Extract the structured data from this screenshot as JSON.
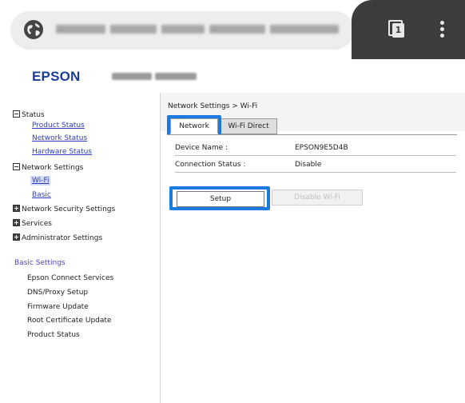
{
  "browser": {
    "globe_icon": "globe-icon",
    "tabs_count": "1",
    "menu_icon": "more-vert-icon"
  },
  "header": {
    "logo": "EPSON"
  },
  "sidebar": {
    "status": "Status",
    "product_status": "Product Status",
    "network_status": "Network Status",
    "hardware_status": "Hardware Status",
    "network_settings": "Network Settings",
    "wifi": "Wi-Fi",
    "basic": "Basic",
    "network_security_settings": "Network Security Settings",
    "services": "Services",
    "administrator_settings": "Administrator Settings",
    "basic_settings_title": "Basic Settings",
    "basic_settings_items": [
      "Epson Connect Services",
      "DNS/Proxy Setup",
      "Firmware Update",
      "Root Certificate Update",
      "Product Status"
    ]
  },
  "main": {
    "breadcrumb": "Network Settings > Wi-Fi",
    "tabs": [
      {
        "label": "Network"
      },
      {
        "label": "Wi-Fi Direct"
      }
    ],
    "rows": [
      {
        "label": "Device Name :",
        "value": "EPSON9E5D4B"
      },
      {
        "label": "Connection Status :",
        "value": "Disable"
      }
    ],
    "setup_button": "Setup",
    "disable_wifi_button": "Disable Wi-Fi"
  },
  "colors": {
    "highlight": "#1a7ae0",
    "logo": "#1a3e9a",
    "link": "#2b3ec2",
    "chrome_dark": "#3c3c3c"
  }
}
